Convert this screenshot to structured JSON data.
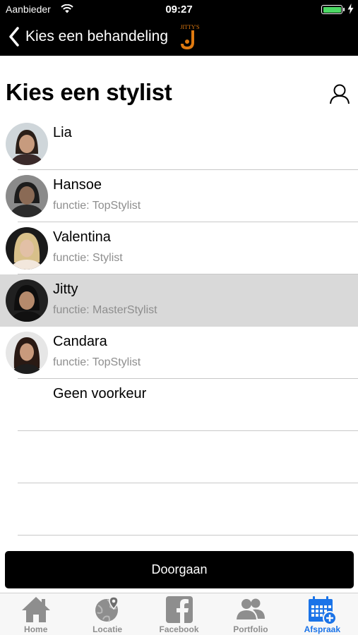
{
  "status_bar": {
    "carrier": "Aanbieder",
    "time": "09:27",
    "battery_level": 1.0
  },
  "nav": {
    "back_label": "Kies een behandeling",
    "logo_text": "Jitty's"
  },
  "page": {
    "title": "Kies een stylist"
  },
  "stylists": [
    {
      "name": "Lia",
      "role": ""
    },
    {
      "name": "Hansoe",
      "role": "functie: TopStylist"
    },
    {
      "name": "Valentina",
      "role": "functie: Stylist"
    },
    {
      "name": "Jitty",
      "role": "functie: MasterStylist",
      "selected": true
    },
    {
      "name": "Candara",
      "role": "functie: TopStylist"
    },
    {
      "name": "Geen voorkeur",
      "role": ""
    }
  ],
  "continue_label": "Doorgaan",
  "tabs": [
    {
      "label": "Home",
      "icon": "home-icon"
    },
    {
      "label": "Locatie",
      "icon": "globe-pin-icon"
    },
    {
      "label": "Facebook",
      "icon": "facebook-icon"
    },
    {
      "label": "Portfolio",
      "icon": "people-icon"
    },
    {
      "label": "Afspraak",
      "icon": "calendar-add-icon",
      "active": true
    }
  ],
  "colors": {
    "accent": "#1a73e8",
    "selected_row": "#d9d9d9",
    "battery": "#4cd964",
    "logo": "#e07a10"
  }
}
